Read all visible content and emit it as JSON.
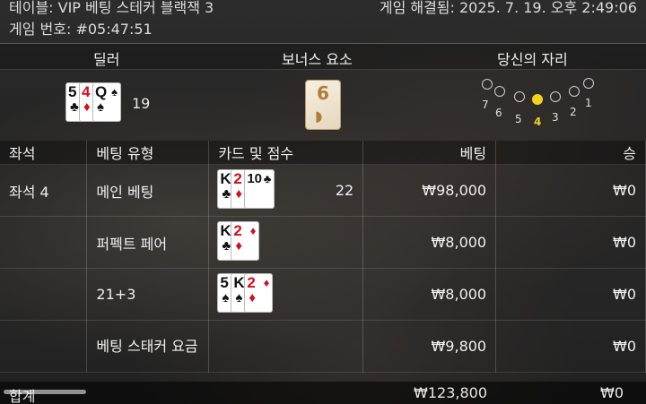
{
  "header": {
    "table_name": "테이블: VIP 베팅 스테커 블랙잭 3",
    "settled": "게임 해결됨: 2025. 7. 19. 오후 2:49:06",
    "game_number": "게임 번호: #05:47:51"
  },
  "sections": {
    "dealer": "딜러",
    "bonus": "보너스 요소",
    "your_seat": "당신의 자리"
  },
  "dealer": {
    "cards": [
      {
        "rank": "5",
        "suit": "♣"
      },
      {
        "rank": "4",
        "suit": "♦"
      },
      {
        "rank": "Q",
        "suit": "♠"
      }
    ],
    "score": "19"
  },
  "bonus": {
    "value": "6"
  },
  "seats": {
    "1": "1",
    "2": "2",
    "3": "3",
    "4": "4",
    "5": "5",
    "6": "6",
    "7": "7",
    "selected": 4
  },
  "table": {
    "headers": [
      "좌석",
      "베팅 유형",
      "카드 및 점수",
      "베팅",
      "승"
    ],
    "rows": [
      {
        "seat": "좌석 4",
        "type": "메인 베팅",
        "cards": [
          {
            "rank": "K",
            "suit": "♣"
          },
          {
            "rank": "2",
            "suit": "♦"
          },
          {
            "rank": "10",
            "suit": "♣"
          }
        ],
        "score": "22",
        "bet": "₩98,000",
        "win": "₩0"
      },
      {
        "type": "퍼펙트 페어",
        "cards": [
          {
            "rank": "K",
            "suit": "♣"
          },
          {
            "rank": "2",
            "suit": "♦"
          }
        ],
        "bet": "₩8,000",
        "win": "₩0"
      },
      {
        "type": "21+3",
        "cards": [
          {
            "rank": "5",
            "suit": "♠"
          },
          {
            "rank": "K",
            "suit": "♠"
          },
          {
            "rank": "2",
            "suit": "♦"
          }
        ],
        "bet": "₩8,000",
        "win": "₩0"
      },
      {
        "type": "베팅 스태커 요금",
        "bet": "₩9,800",
        "win": "₩0"
      }
    ]
  },
  "totals": {
    "label": "합계",
    "bet": "₩123,800",
    "win": "₩0"
  },
  "colors": {
    "accent": "#f2d21d",
    "red_suit": "#d10f1f"
  }
}
